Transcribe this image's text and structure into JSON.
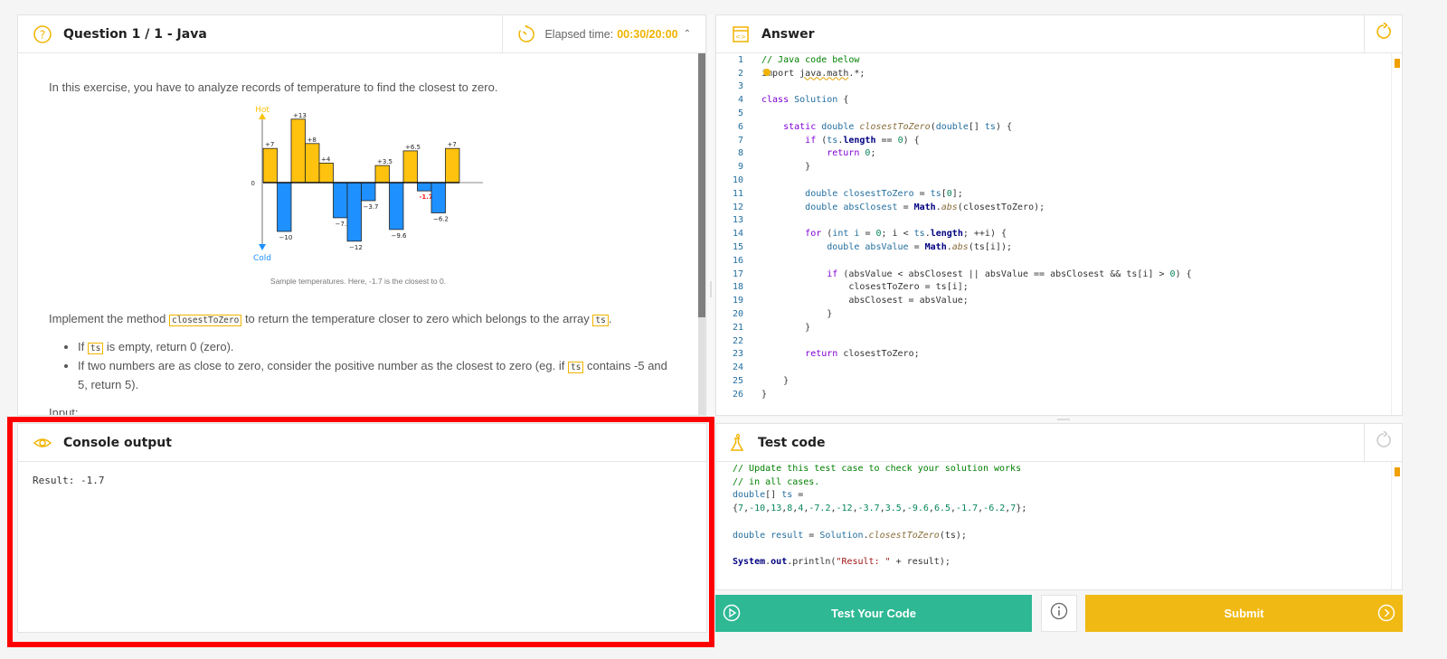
{
  "question": {
    "title": "Question 1 / 1 - Java",
    "timer_label": "Elapsed time:",
    "timer_value": "00:30/20:00",
    "intro": "In this exercise, you have to analyze records of temperature to find the closest to zero.",
    "chart_caption": "Sample temperatures. Here, -1.7 is the closest to 0.",
    "impl_before": "Implement the method ",
    "impl_method": "closestToZero",
    "impl_middle": " to return the temperature closer to zero which belongs to the array ",
    "impl_array": "ts",
    "impl_after": ".",
    "bullets": [
      {
        "before": "If ",
        "code": "ts",
        "after": " is empty, return 0 (zero)."
      },
      {
        "before": "If two numbers are as close to zero, consider the positive number as the closest to zero (eg. if ",
        "code": "ts",
        "after": " contains -5 and 5, return 5)."
      }
    ],
    "input_label": "Input:"
  },
  "chart_data": {
    "type": "bar",
    "title": "",
    "caption": "Sample temperatures. Here, -1.7 is the closest to 0.",
    "y_top_label": "Hot",
    "y_bottom_label": "Cold",
    "zero_label": "0",
    "values": [
      7,
      -10,
      13,
      8,
      4,
      -7.2,
      -12,
      -3.7,
      3.5,
      -9.6,
      6.5,
      -1.7,
      -6.2,
      7
    ],
    "labels": [
      "+7",
      "−10",
      "+13",
      "+8",
      "+4",
      "−7.2",
      "−12",
      "−3.7",
      "+3.5",
      "−9.6",
      "+6.5",
      "-1.7",
      "−6.2",
      "+7"
    ],
    "highlight_index": 11,
    "ylim": [
      -13,
      13
    ],
    "colors": {
      "positive": "#ffc20e",
      "negative": "#1e90ff",
      "highlight_label": "#ff2020",
      "hot": "#ffc20e",
      "cold": "#1e90ff"
    }
  },
  "console": {
    "title": "Console output",
    "output": "Result: -1.7"
  },
  "answer": {
    "title": "Answer",
    "lines": [
      [
        [
          "comment",
          "// Java code below"
        ]
      ],
      [
        [
          "plain",
          "im"
        ],
        [
          "plain",
          "port "
        ],
        [
          "squig",
          "java.math"
        ],
        [
          "plain",
          ".*;"
        ]
      ],
      [],
      [
        [
          "kw",
          "class "
        ],
        [
          "cls",
          "Solution"
        ],
        [
          "plain",
          " {"
        ]
      ],
      [],
      [
        [
          "plain",
          "    "
        ],
        [
          "kw",
          "static "
        ],
        [
          "type",
          "double "
        ],
        [
          "fn",
          "closestToZero"
        ],
        [
          "plain",
          "("
        ],
        [
          "type",
          "double"
        ],
        [
          "plain",
          "[] "
        ],
        [
          "type",
          "ts"
        ],
        [
          "plain",
          ") {"
        ]
      ],
      [
        [
          "plain",
          "        "
        ],
        [
          "kw",
          "if "
        ],
        [
          "plain",
          "("
        ],
        [
          "type",
          "ts"
        ],
        [
          "plain",
          "."
        ],
        [
          "bold",
          "length"
        ],
        [
          "plain",
          " == "
        ],
        [
          "num",
          "0"
        ],
        [
          "plain",
          ") {"
        ]
      ],
      [
        [
          "plain",
          "            "
        ],
        [
          "kw",
          "return "
        ],
        [
          "num",
          "0"
        ],
        [
          "plain",
          ";"
        ]
      ],
      [
        [
          "plain",
          "        }"
        ]
      ],
      [],
      [
        [
          "plain",
          "        "
        ],
        [
          "type",
          "double "
        ],
        [
          "type",
          "closestToZero"
        ],
        [
          "plain",
          " = "
        ],
        [
          "type",
          "ts"
        ],
        [
          "plain",
          "["
        ],
        [
          "num",
          "0"
        ],
        [
          "plain",
          "];"
        ]
      ],
      [
        [
          "plain",
          "        "
        ],
        [
          "type",
          "double "
        ],
        [
          "type",
          "absClosest"
        ],
        [
          "plain",
          " = "
        ],
        [
          "bold",
          "Math"
        ],
        [
          "plain",
          "."
        ],
        [
          "fn",
          "abs"
        ],
        [
          "plain",
          "(closestToZero);"
        ]
      ],
      [],
      [
        [
          "plain",
          "        "
        ],
        [
          "kw",
          "for "
        ],
        [
          "plain",
          "("
        ],
        [
          "type",
          "int "
        ],
        [
          "type",
          "i"
        ],
        [
          "plain",
          " = "
        ],
        [
          "num",
          "0"
        ],
        [
          "plain",
          "; i < "
        ],
        [
          "type",
          "ts"
        ],
        [
          "plain",
          "."
        ],
        [
          "bold",
          "length"
        ],
        [
          "plain",
          "; ++i) {"
        ]
      ],
      [
        [
          "plain",
          "            "
        ],
        [
          "type",
          "double "
        ],
        [
          "type",
          "absValue"
        ],
        [
          "plain",
          " = "
        ],
        [
          "bold",
          "Math"
        ],
        [
          "plain",
          "."
        ],
        [
          "fn",
          "abs"
        ],
        [
          "plain",
          "(ts[i]);"
        ]
      ],
      [],
      [
        [
          "plain",
          "            "
        ],
        [
          "kw",
          "if "
        ],
        [
          "plain",
          "(absValue < absClosest || absValue == absClosest && ts[i] > "
        ],
        [
          "num",
          "0"
        ],
        [
          "plain",
          ") {"
        ]
      ],
      [
        [
          "plain",
          "                closestToZero = ts[i];"
        ]
      ],
      [
        [
          "plain",
          "                absClosest = absValue;"
        ]
      ],
      [
        [
          "plain",
          "            }"
        ]
      ],
      [
        [
          "plain",
          "        }"
        ]
      ],
      [],
      [
        [
          "plain",
          "        "
        ],
        [
          "kw",
          "return "
        ],
        [
          "plain",
          "closestToZero;"
        ]
      ],
      [],
      [
        [
          "plain",
          "    }"
        ]
      ],
      [
        [
          "plain",
          "}"
        ]
      ]
    ]
  },
  "testcode": {
    "title": "Test code",
    "lines": [
      [
        [
          "comment",
          "// Update this test case to check your solution works"
        ]
      ],
      [
        [
          "comment",
          "// in all cases."
        ]
      ],
      [
        [
          "type",
          "double"
        ],
        [
          "plain",
          "[] "
        ],
        [
          "type",
          "ts"
        ],
        [
          "plain",
          " ="
        ]
      ],
      [
        [
          "plain",
          "{"
        ],
        [
          "num",
          "7"
        ],
        [
          "plain",
          ","
        ],
        [
          "num",
          "-10"
        ],
        [
          "plain",
          ","
        ],
        [
          "num",
          "13"
        ],
        [
          "plain",
          ","
        ],
        [
          "num",
          "8"
        ],
        [
          "plain",
          ","
        ],
        [
          "num",
          "4"
        ],
        [
          "plain",
          ","
        ],
        [
          "num",
          "-7.2"
        ],
        [
          "plain",
          ","
        ],
        [
          "num",
          "-12"
        ],
        [
          "plain",
          ","
        ],
        [
          "num",
          "-3.7"
        ],
        [
          "plain",
          ","
        ],
        [
          "num",
          "3.5"
        ],
        [
          "plain",
          ","
        ],
        [
          "num",
          "-9.6"
        ],
        [
          "plain",
          ","
        ],
        [
          "num",
          "6.5"
        ],
        [
          "plain",
          ","
        ],
        [
          "num",
          "-1.7"
        ],
        [
          "plain",
          ","
        ],
        [
          "num",
          "-6.2"
        ],
        [
          "plain",
          ","
        ],
        [
          "num",
          "7"
        ],
        [
          "plain",
          "};"
        ]
      ],
      [],
      [
        [
          "type",
          "double "
        ],
        [
          "type",
          "result"
        ],
        [
          "plain",
          " = "
        ],
        [
          "cls",
          "Solution"
        ],
        [
          "plain",
          "."
        ],
        [
          "fn",
          "closestToZero"
        ],
        [
          "plain",
          "(ts);"
        ]
      ],
      [],
      [
        [
          "bold",
          "System"
        ],
        [
          "plain",
          "."
        ],
        [
          "bold",
          "out"
        ],
        [
          "plain",
          "."
        ],
        [
          "plain",
          "println("
        ],
        [
          "str",
          "\"Result: \""
        ],
        [
          "plain",
          " + result);"
        ]
      ]
    ]
  },
  "actions": {
    "test_label": "Test Your Code",
    "submit_label": "Submit"
  },
  "colors": {
    "accent": "#f0b400",
    "test_button": "#2eb894",
    "submit_button": "#f0b914",
    "highlight_outline": "#ff0000"
  }
}
